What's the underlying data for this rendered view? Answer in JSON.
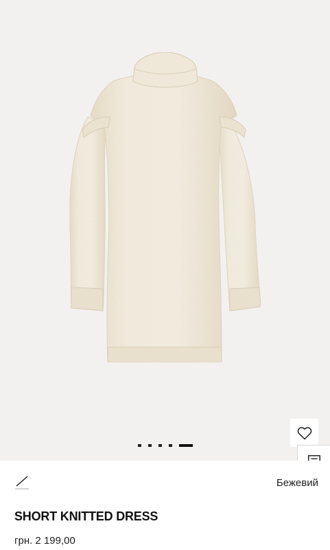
{
  "product": {
    "title": "SHORT KNITTED DRESS",
    "price": "грн. 2 199,00",
    "color_name": "Бежевий",
    "image_icon": "knit-dress-photo",
    "main_color": "#f3ebdc"
  },
  "gallery": {
    "total_slides": 5,
    "active_slide": 5
  },
  "actions": {
    "wishlist_icon": "heart-outline-icon",
    "chat_icon": "chat-bubble-icon",
    "swatch_icon": "no-color-slash-icon"
  },
  "colors": {
    "background": "#f2f1ef",
    "text": "#111111",
    "garment": "#f3ebdc"
  }
}
